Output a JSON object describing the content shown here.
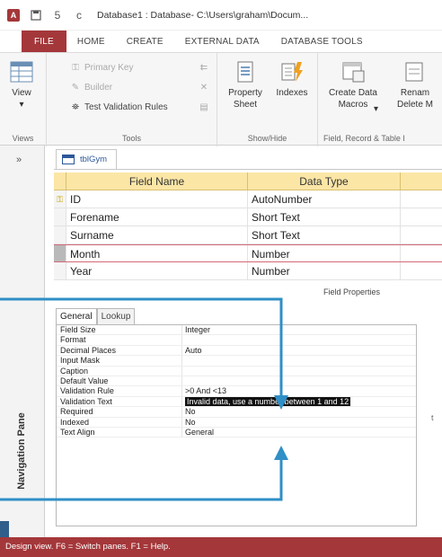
{
  "titlebar": {
    "app_letter": "A",
    "title": "Database1 : Database- C:\\Users\\graham\\Docum...",
    "undo_label": "5",
    "redo_label": "c"
  },
  "tabs": [
    {
      "label": "FILE"
    },
    {
      "label": "HOME"
    },
    {
      "label": "CREATE"
    },
    {
      "label": "EXTERNAL DATA"
    },
    {
      "label": "DATABASE TOOLS"
    }
  ],
  "ribbon": {
    "views": {
      "view_label": "View",
      "group_label": "Views"
    },
    "tools": {
      "primary_key": "Primary Key",
      "builder": "Builder",
      "test_validation": "Test Validation Rules",
      "group_label": "Tools"
    },
    "showhide": {
      "property_sheet": "Property Sheet",
      "indexes": "Indexes",
      "group_label": "Show/Hide"
    },
    "field_events": {
      "create_macros": "Create Data Macros",
      "rename_delete": "Renam Delete M",
      "group_label": "Field, Record & Table I"
    }
  },
  "nav": {
    "toggle": "»",
    "label": "Navigation Pane"
  },
  "object_tab": {
    "label": "tblGym"
  },
  "grid": {
    "headers": [
      "Field Name",
      "Data Type"
    ],
    "rows": [
      {
        "key": true,
        "name": "ID",
        "type": "AutoNumber"
      },
      {
        "key": false,
        "name": "Forename",
        "type": "Short Text"
      },
      {
        "key": false,
        "name": "Surname",
        "type": "Short Text"
      },
      {
        "key": false,
        "name": "Month",
        "type": "Number",
        "current": true
      },
      {
        "key": false,
        "name": "Year",
        "type": "Number"
      }
    ]
  },
  "field_properties": {
    "label": "Field Properties",
    "tabs": [
      "General",
      "Lookup"
    ],
    "rows": [
      {
        "name": "Field Size",
        "value": "Integer"
      },
      {
        "name": "Format",
        "value": ""
      },
      {
        "name": "Decimal Places",
        "value": "Auto"
      },
      {
        "name": "Input Mask",
        "value": ""
      },
      {
        "name": "Caption",
        "value": ""
      },
      {
        "name": "Default Value",
        "value": ""
      },
      {
        "name": "Validation Rule",
        "value": ">0 And <13"
      },
      {
        "name": "Validation Text",
        "value": "Invalid data, use a number between 1 and 12",
        "highlight": true
      },
      {
        "name": "Required",
        "value": "No"
      },
      {
        "name": "Indexed",
        "value": "No"
      },
      {
        "name": "Text Align",
        "value": "General"
      }
    ],
    "side_char": "t"
  },
  "statusbar": {
    "text": "Design view.  F6 = Switch panes.  F1 = Help."
  },
  "colors": {
    "brand": "#a4373a",
    "header_yellow": "#fbe6a6",
    "arrow_blue": "#2f8fc6"
  }
}
